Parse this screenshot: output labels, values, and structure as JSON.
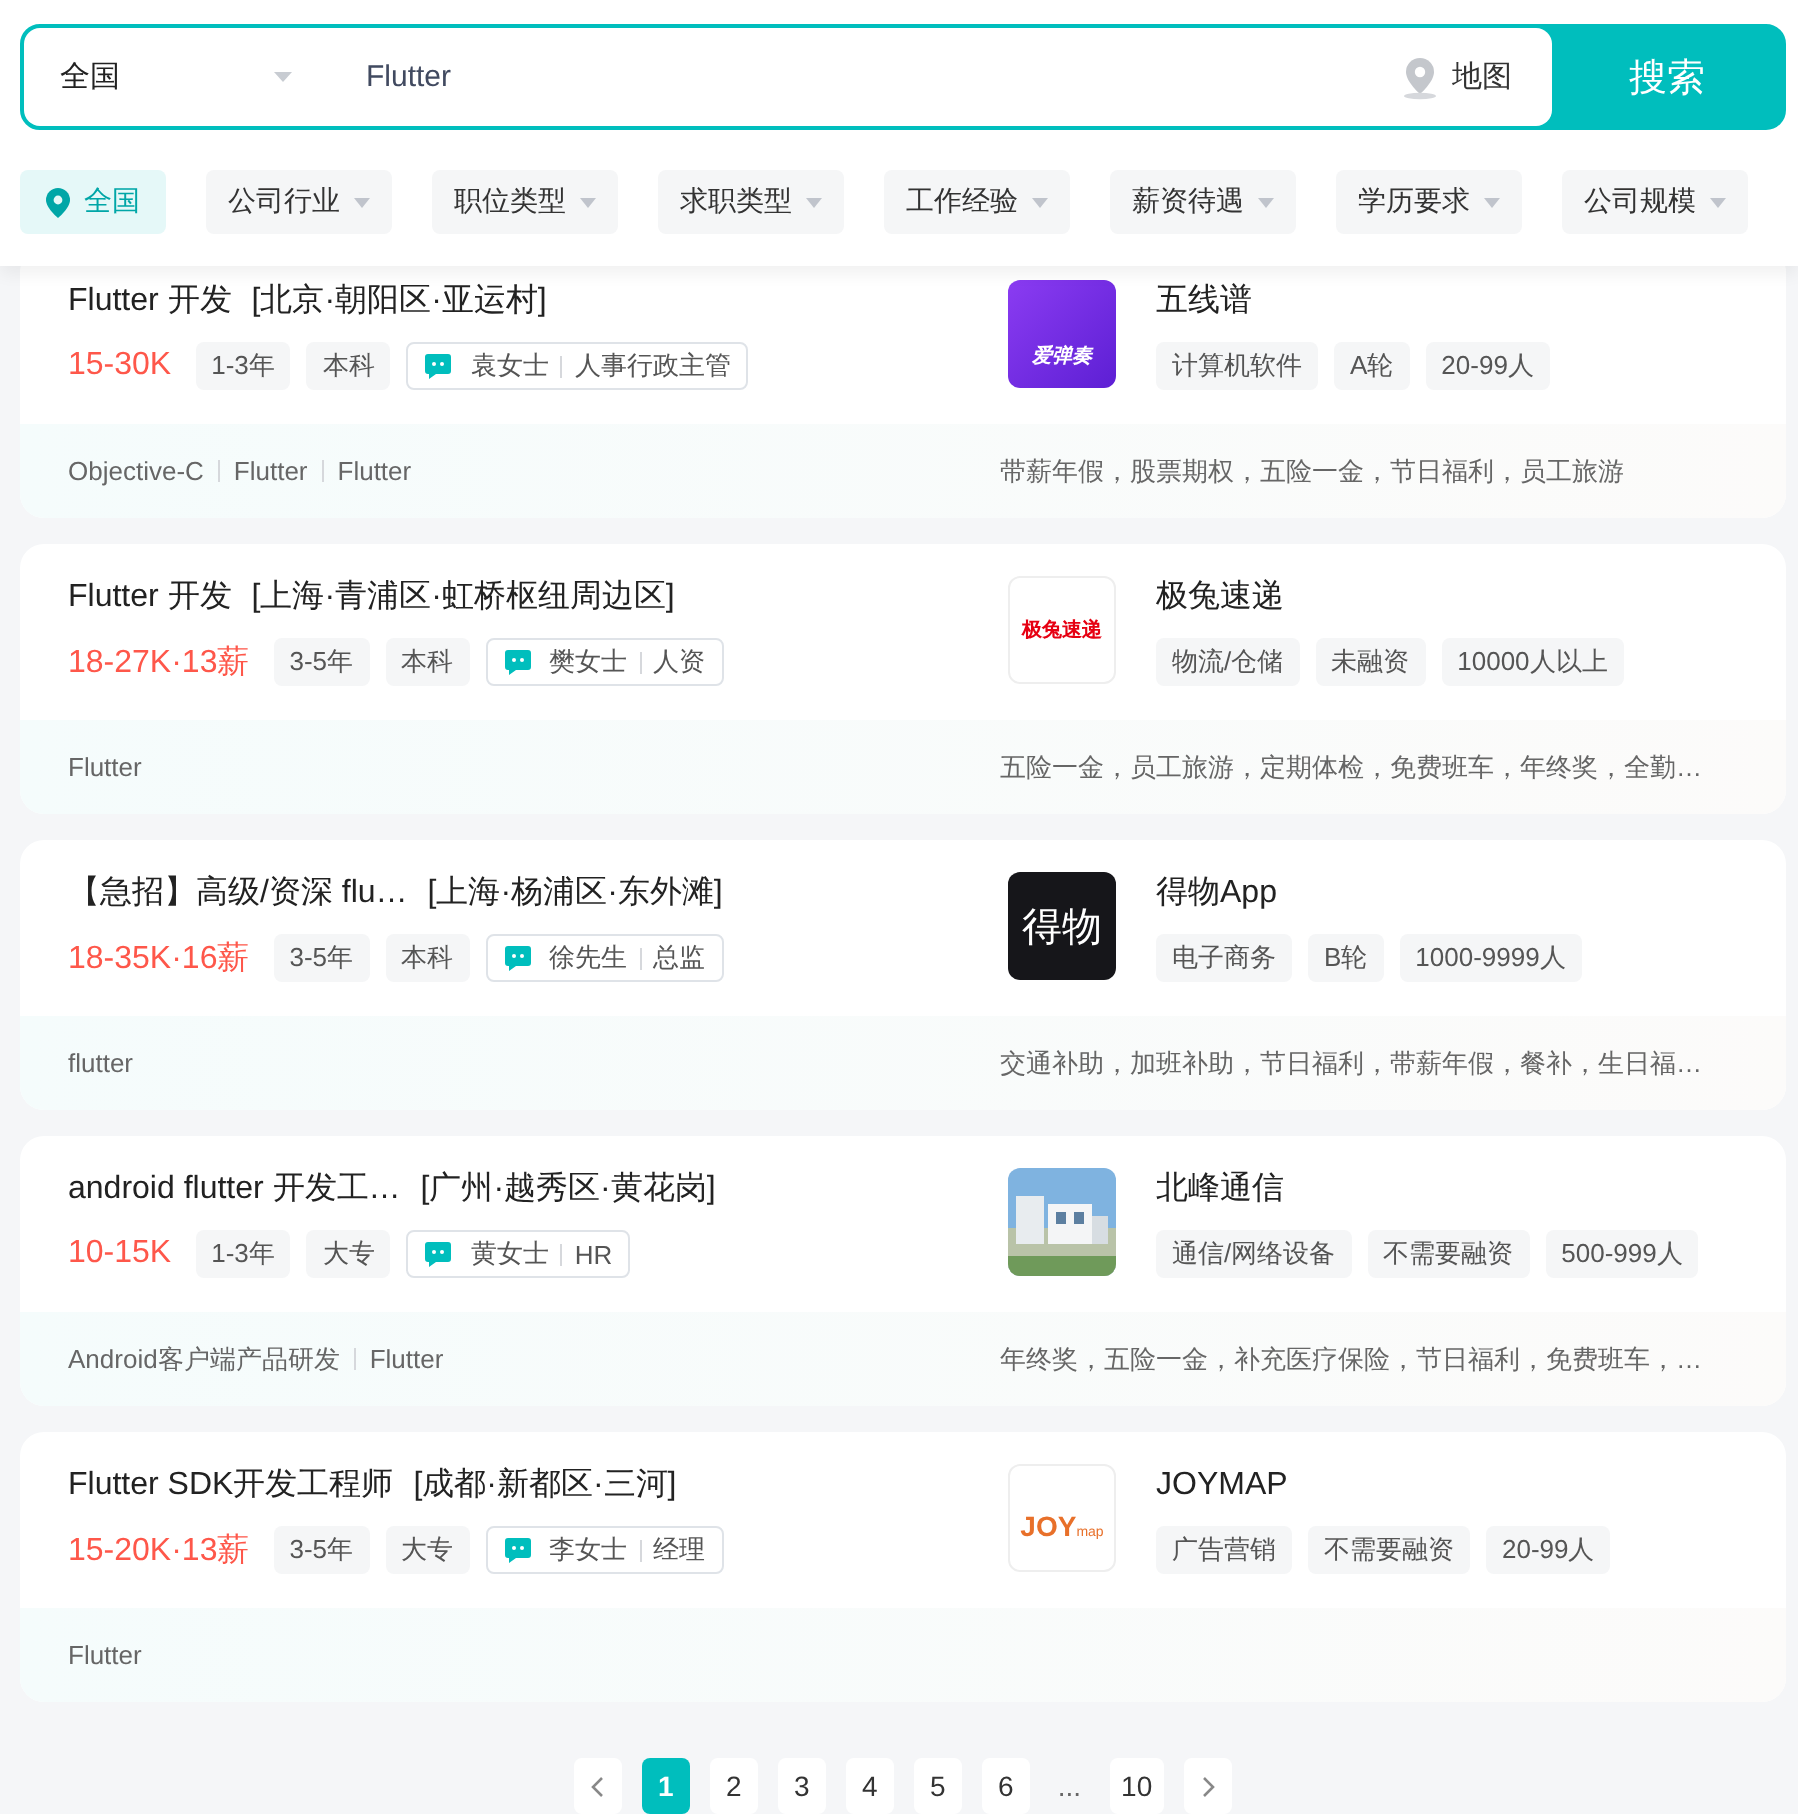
{
  "search": {
    "city": "全国",
    "query": "Flutter",
    "map_label": "地图",
    "button": "搜索"
  },
  "filters": [
    {
      "label": "全国",
      "kind": "location",
      "selected": true
    },
    {
      "label": "公司行业",
      "kind": "dropdown",
      "selected": false
    },
    {
      "label": "职位类型",
      "kind": "dropdown",
      "selected": false
    },
    {
      "label": "求职类型",
      "kind": "dropdown",
      "selected": false
    },
    {
      "label": "工作经验",
      "kind": "dropdown",
      "selected": false
    },
    {
      "label": "薪资待遇",
      "kind": "dropdown",
      "selected": false
    },
    {
      "label": "学历要求",
      "kind": "dropdown",
      "selected": false
    },
    {
      "label": "公司规模",
      "kind": "dropdown",
      "selected": false
    }
  ],
  "jobs": [
    {
      "title": "Flutter 开发",
      "location": "[北京·朝阳区·亚运村]",
      "salary": "15-30K",
      "tags": [
        "1-3年",
        "本科"
      ],
      "recruiter": "袁女士",
      "role": "人事行政主管",
      "skills": [
        "Objective-C",
        "Flutter",
        "Flutter"
      ],
      "benefits": "带薪年假，股票期权，五险一金，节日福利，员工旅游",
      "company": "五线谱",
      "logo": {
        "kind": "purple",
        "text": "爱弹奏"
      },
      "company_tags": [
        "计算机软件",
        "A轮",
        "20-99人"
      ]
    },
    {
      "title": "Flutter 开发",
      "location": "[上海·青浦区·虹桥枢纽周边区]",
      "salary": "18-27K·13薪",
      "tags": [
        "3-5年",
        "本科"
      ],
      "recruiter": "樊女士",
      "role": "人资",
      "skills": [
        "Flutter"
      ],
      "benefits": "五险一金，员工旅游，定期体检，免费班车，年终奖，全勤…",
      "company": "极兔速递",
      "logo": {
        "kind": "red",
        "text": "极兔速递"
      },
      "company_tags": [
        "物流/仓储",
        "未融资",
        "10000人以上"
      ]
    },
    {
      "title": "【急招】高级/资深 flu…",
      "location": "[上海·杨浦区·东外滩]",
      "salary": "18-35K·16薪",
      "tags": [
        "3-5年",
        "本科"
      ],
      "recruiter": "徐先生",
      "role": "总监",
      "skills": [
        "flutter"
      ],
      "benefits": "交通补助，加班补助，节日福利，带薪年假，餐补，生日福…",
      "company": "得物App",
      "logo": {
        "kind": "dark",
        "text": "得物"
      },
      "company_tags": [
        "电子商务",
        "B轮",
        "1000-9999人"
      ]
    },
    {
      "title": "android flutter 开发工…",
      "location": "[广州·越秀区·黄花岗]",
      "salary": "10-15K",
      "tags": [
        "1-3年",
        "大专"
      ],
      "recruiter": "黄女士",
      "role": "HR",
      "skills": [
        "Android客户端产品研发",
        "Flutter"
      ],
      "benefits": "年终奖，五险一金，补充医疗保险，节日福利，免费班车，…",
      "company": "北峰通信",
      "logo": {
        "kind": "picture"
      },
      "company_tags": [
        "通信/网络设备",
        "不需要融资",
        "500-999人"
      ]
    },
    {
      "title": "Flutter SDK开发工程师",
      "location": "[成都·新都区·三河]",
      "salary": "15-20K·13薪",
      "tags": [
        "3-5年",
        "大专"
      ],
      "recruiter": "李女士",
      "role": "经理",
      "skills": [
        "Flutter"
      ],
      "company": "JOYMAP",
      "logo": {
        "kind": "joy",
        "text": "JOY",
        "sub": "map"
      },
      "company_tags": [
        "广告营销",
        "不需要融资",
        "20-99人"
      ]
    }
  ],
  "pagination": [
    {
      "kind": "page",
      "label": "1",
      "selected": true
    },
    {
      "kind": "page",
      "label": "2",
      "selected": false
    },
    {
      "kind": "page",
      "label": "3",
      "selected": false
    },
    {
      "kind": "page",
      "label": "4",
      "selected": false
    },
    {
      "kind": "page",
      "label": "5",
      "selected": false
    },
    {
      "kind": "page",
      "label": "6",
      "selected": false
    },
    {
      "kind": "ellipsis",
      "label": "..."
    },
    {
      "kind": "page",
      "label": "10",
      "selected": false
    }
  ]
}
